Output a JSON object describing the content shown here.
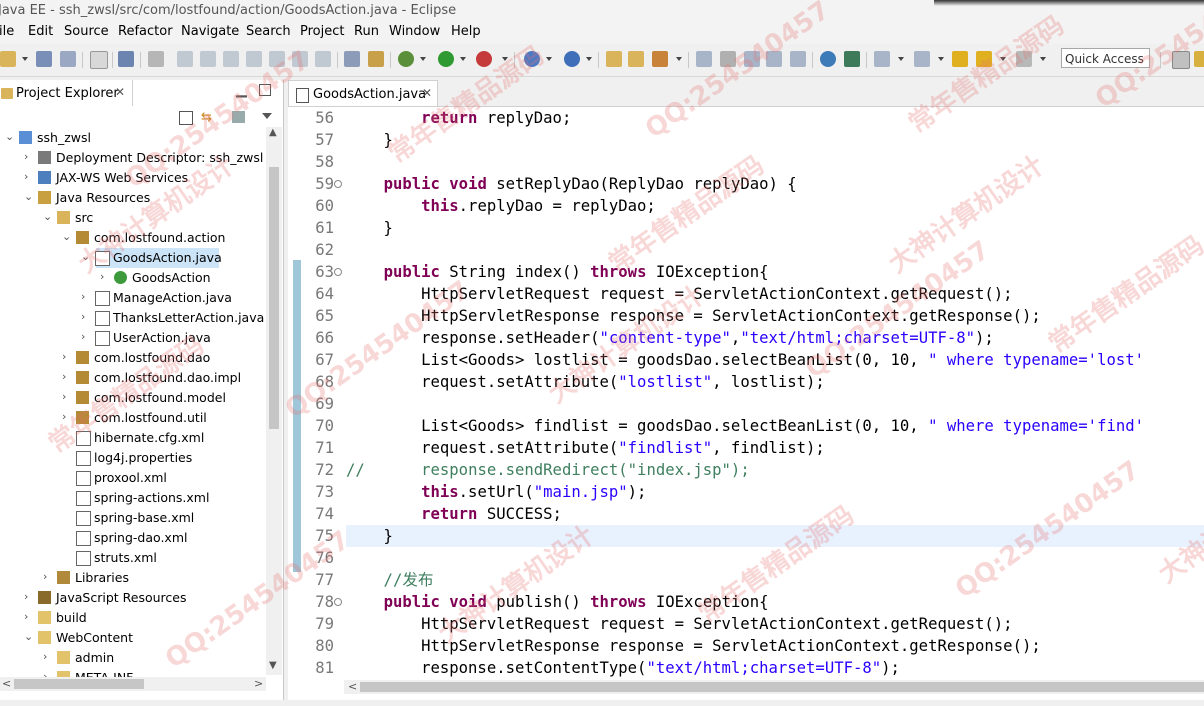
{
  "window": {
    "title": "Java EE - ssh_zwsl/src/com/lostfound/action/GoodsAction.java - Eclipse"
  },
  "menu": [
    "File",
    "Edit",
    "Source",
    "Refactor",
    "Navigate",
    "Search",
    "Project",
    "Run",
    "Window",
    "Help"
  ],
  "menu_display": [
    "ile",
    "Edit",
    "Source",
    "Refactor",
    "Navigate",
    "Search",
    "Project",
    "Run",
    "Window",
    "Help"
  ],
  "toolbar": {
    "quick_access": "Quick Access"
  },
  "explorer": {
    "title": "Project Explorer",
    "tree": [
      {
        "label": "ssh_zwsl",
        "icon": "project-icon",
        "expanded": true
      },
      {
        "label": "Deployment Descriptor: ssh_zwsl",
        "icon": "descriptor-icon"
      },
      {
        "label": "JAX-WS Web Services",
        "icon": "webservice-icon"
      },
      {
        "label": "Java Resources",
        "icon": "java-resources-icon",
        "expanded": true
      },
      {
        "label": "src",
        "icon": "source-folder-icon",
        "expanded": true
      },
      {
        "label": "com.lostfound.action",
        "icon": "package-icon",
        "expanded": true
      },
      {
        "label": "GoodsAction.java",
        "icon": "java-file-icon",
        "expanded": true,
        "selected": true
      },
      {
        "label": "GoodsAction",
        "icon": "class-icon"
      },
      {
        "label": "ManageAction.java",
        "icon": "java-file-icon"
      },
      {
        "label": "ThanksLetterAction.java",
        "icon": "java-file-icon"
      },
      {
        "label": "UserAction.java",
        "icon": "java-file-icon"
      },
      {
        "label": "com.lostfound.dao",
        "icon": "package-icon"
      },
      {
        "label": "com.lostfound.dao.impl",
        "icon": "package-icon"
      },
      {
        "label": "com.lostfound.model",
        "icon": "package-icon"
      },
      {
        "label": "com.lostfound.util",
        "icon": "package-icon"
      },
      {
        "label": "hibernate.cfg.xml",
        "icon": "xml-file-icon"
      },
      {
        "label": "log4j.properties",
        "icon": "properties-file-icon"
      },
      {
        "label": "proxool.xml",
        "icon": "xml-file-icon"
      },
      {
        "label": "spring-actions.xml",
        "icon": "xml-file-icon"
      },
      {
        "label": "spring-base.xml",
        "icon": "xml-file-icon"
      },
      {
        "label": "spring-dao.xml",
        "icon": "xml-file-icon"
      },
      {
        "label": "struts.xml",
        "icon": "xml-file-icon"
      },
      {
        "label": "Libraries",
        "icon": "library-icon"
      },
      {
        "label": "JavaScript Resources",
        "icon": "js-resources-icon"
      },
      {
        "label": "build",
        "icon": "folder-icon"
      },
      {
        "label": "WebContent",
        "icon": "folder-icon",
        "expanded": true
      },
      {
        "label": "admin",
        "icon": "folder-icon"
      },
      {
        "label": "META-INF",
        "icon": "folder-icon"
      }
    ]
  },
  "editor": {
    "tab_label": "GoodsAction.java",
    "lines": [
      {
        "n": "56",
        "text": "        return replyDao;"
      },
      {
        "n": "57",
        "text": "    }"
      },
      {
        "n": "58",
        "text": ""
      },
      {
        "n": "59",
        "text": "    public void setReplyDao(ReplyDao replyDao) {"
      },
      {
        "n": "60",
        "text": "        this.replyDao = replyDao;"
      },
      {
        "n": "61",
        "text": "    }"
      },
      {
        "n": "62",
        "text": ""
      },
      {
        "n": "63",
        "text": "    public String index() throws IOException{"
      },
      {
        "n": "64",
        "text": "        HttpServletRequest request = ServletActionContext.getRequest();"
      },
      {
        "n": "65",
        "text": "        HttpServletResponse response = ServletActionContext.getResponse();"
      },
      {
        "n": "66",
        "text": "        response.setHeader(\"content-type\",\"text/html;charset=UTF-8\");"
      },
      {
        "n": "67",
        "text": "        List<Goods> lostlist = goodsDao.selectBeanList(0, 10, \" where typename='lost'"
      },
      {
        "n": "68",
        "text": "        request.setAttribute(\"lostlist\", lostlist);"
      },
      {
        "n": "69",
        "text": ""
      },
      {
        "n": "70",
        "text": "        List<Goods> findlist = goodsDao.selectBeanList(0, 10, \" where typename='find'"
      },
      {
        "n": "71",
        "text": "        request.setAttribute(\"findlist\", findlist);"
      },
      {
        "n": "72",
        "text": "//      response.sendRedirect(\"index.jsp\");"
      },
      {
        "n": "73",
        "text": "        this.setUrl(\"main.jsp\");"
      },
      {
        "n": "74",
        "text": "        return SUCCESS;"
      },
      {
        "n": "75",
        "text": "    }"
      },
      {
        "n": "76",
        "text": ""
      },
      {
        "n": "77",
        "text": "    //发布"
      },
      {
        "n": "78",
        "text": "    public void publish() throws IOException{"
      },
      {
        "n": "79",
        "text": "        HttpServletRequest request = ServletActionContext.getRequest();"
      },
      {
        "n": "80",
        "text": "        HttpServletResponse response = ServletActionContext.getResponse();"
      },
      {
        "n": "81",
        "text": "        response.setContentType(\"text/html;charset=UTF-8\");"
      }
    ]
  },
  "watermark": [
    "QQ:254540457",
    "常年售精品源码",
    "大神计算机设计"
  ]
}
